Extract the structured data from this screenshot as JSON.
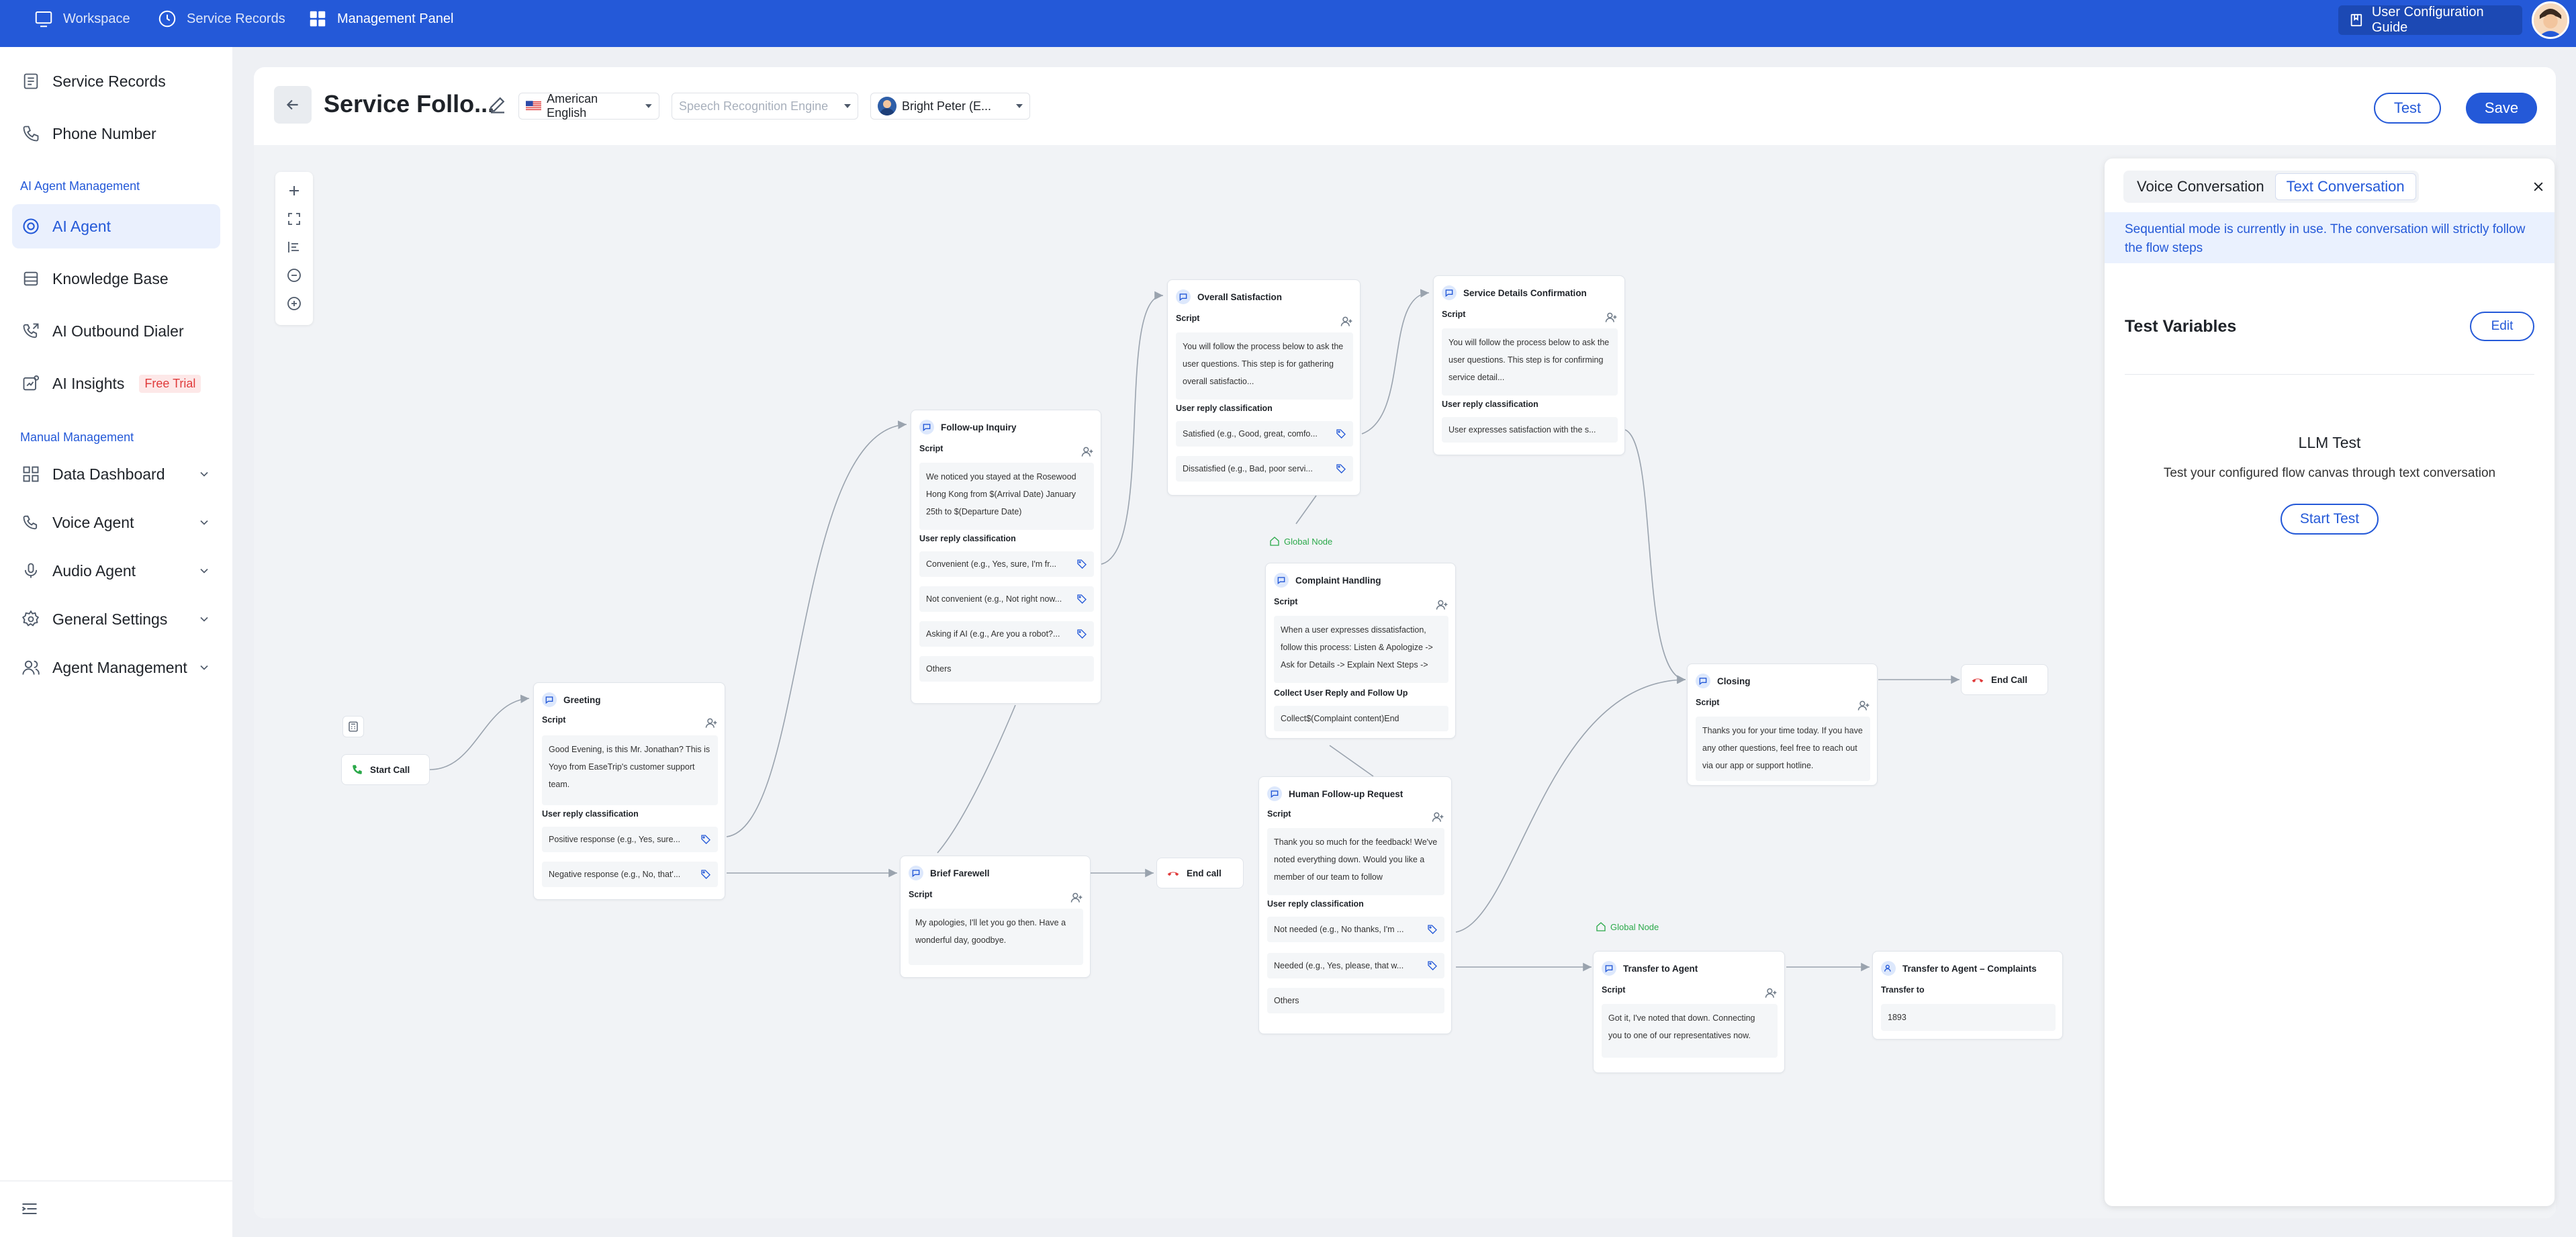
{
  "topbar": {
    "nav": [
      {
        "label": "Workspace",
        "icon": "monitor-icon"
      },
      {
        "label": "Service Records",
        "icon": "clock-icon"
      },
      {
        "label": "Management Panel",
        "icon": "grid-icon"
      }
    ],
    "guide_label": "User Configuration Guide"
  },
  "sidebar": {
    "items_top": [
      {
        "label": "Service Records",
        "icon": "document-icon"
      },
      {
        "label": "Phone Number",
        "icon": "phone-icon"
      }
    ],
    "group1": "AI Agent Management",
    "items_ai": [
      {
        "label": "AI Agent",
        "icon": "ai-agent-icon"
      },
      {
        "label": "Knowledge Base",
        "icon": "database-icon"
      },
      {
        "label": "AI Outbound Dialer",
        "icon": "outbound-call-icon"
      },
      {
        "label": "AI Insights",
        "icon": "insights-icon",
        "badge": "Free Trial"
      }
    ],
    "group2": "Manual Management",
    "items_manual": [
      {
        "label": "Data Dashboard",
        "icon": "dashboard-icon"
      },
      {
        "label": "Voice Agent",
        "icon": "voice-agent-icon"
      },
      {
        "label": "Audio Agent",
        "icon": "microphone-icon"
      },
      {
        "label": "General Settings",
        "icon": "gear-icon"
      },
      {
        "label": "Agent Management",
        "icon": "users-icon"
      }
    ]
  },
  "header": {
    "title": "Service Follo...",
    "language": "American English",
    "speech_engine_placeholder": "Speech Recognition Engine",
    "voice": "Bright Peter (E...",
    "test_label": "Test",
    "save_label": "Save"
  },
  "canvas": {
    "start_call": "Start Call",
    "greeting": {
      "title": "Greeting",
      "script_label": "Script",
      "script": "Good Evening, is this Mr. Jonathan? This is Yoyo from EaseTrip's customer support team.",
      "class_label": "User reply classification",
      "options": [
        "Positive response (e.g., Yes, sure...",
        "Negative response (e.g., No, that'..."
      ]
    },
    "followup": {
      "title": "Follow-up Inquiry",
      "script_label": "Script",
      "script": "We noticed you stayed at the Rosewood Hong Kong from $(Arrival Date) January 25th to $(Departure Date)",
      "class_label": "User reply classification",
      "options": [
        "Convenient (e.g., Yes, sure, I'm fr...",
        "Not convenient (e.g., Not right now...",
        "Asking if AI (e.g., Are you a robot?..."
      ],
      "others": "Others"
    },
    "satisfaction": {
      "title": "Overall Satisfaction",
      "script_label": "Script",
      "script": "You will follow the process below to ask the user questions. This step is for gathering overall satisfactio...",
      "class_label": "User reply classification",
      "options": [
        "Satisfied (e.g., Good, great, comfo...",
        "Dissatisfied (e.g., Bad, poor servi..."
      ]
    },
    "service_details": {
      "title": "Service Details Confirmation",
      "script_label": "Script",
      "script": "You will follow the process below to ask the user questions. This step is for confirming service detail...",
      "class_label": "User reply classification",
      "options": [
        "User expresses satisfaction with the s..."
      ]
    },
    "global_node_label": "Global Node",
    "complaint": {
      "title": "Complaint Handling",
      "script_label": "Script",
      "script": "When a user expresses dissatisfaction, follow this process: Listen & Apologize -> Ask for Details -> Explain Next Steps ->",
      "collect_label": "Collect User Reply and Follow Up",
      "collect": "Collect$(Complaint content)End"
    },
    "human_followup": {
      "title": "Human Follow-up Request",
      "script_label": "Script",
      "script": "Thank you so much for the feedback! We've noted everything down. Would you like a member of our team to follow",
      "class_label": "User reply classification",
      "options": [
        "Not needed (e.g., No thanks, I'm ...",
        "Needed (e.g., Yes, please, that w..."
      ],
      "others": "Others"
    },
    "farewell": {
      "title": "Brief Farewell",
      "script_label": "Script",
      "script": "My apologies, I'll let you go then. Have a wonderful day, goodbye."
    },
    "end_call_1": "End call",
    "closing": {
      "title": "Closing",
      "script_label": "Script",
      "script": "Thanks you for your time today. If you have any other questions, feel free to reach out via our app or support hotline."
    },
    "end_call_2": "End Call",
    "transfer": {
      "title": "Transfer to Agent",
      "script_label": "Script",
      "script": "Got it, I've noted that down. Connecting you to one of our representatives now."
    },
    "transfer_complaints": {
      "title": "Transfer to Agent – Complaints",
      "label": "Transfer to",
      "value": "1893"
    }
  },
  "panel": {
    "tabs": [
      "Voice Conversation",
      "Text Conversation"
    ],
    "notice": "Sequential mode is currently in use. The conversation will strictly follow the flow steps",
    "test_vars_title": "Test Variables",
    "edit_label": "Edit",
    "llm_title": "LLM Test",
    "llm_desc": "Test your configured flow canvas through text conversation",
    "start_label": "Start Test"
  },
  "colors": {
    "primary": "#2459d8",
    "global_node": "#2ba94a",
    "end_call": "#e03a3a",
    "badge_bg": "#fde8e8"
  }
}
